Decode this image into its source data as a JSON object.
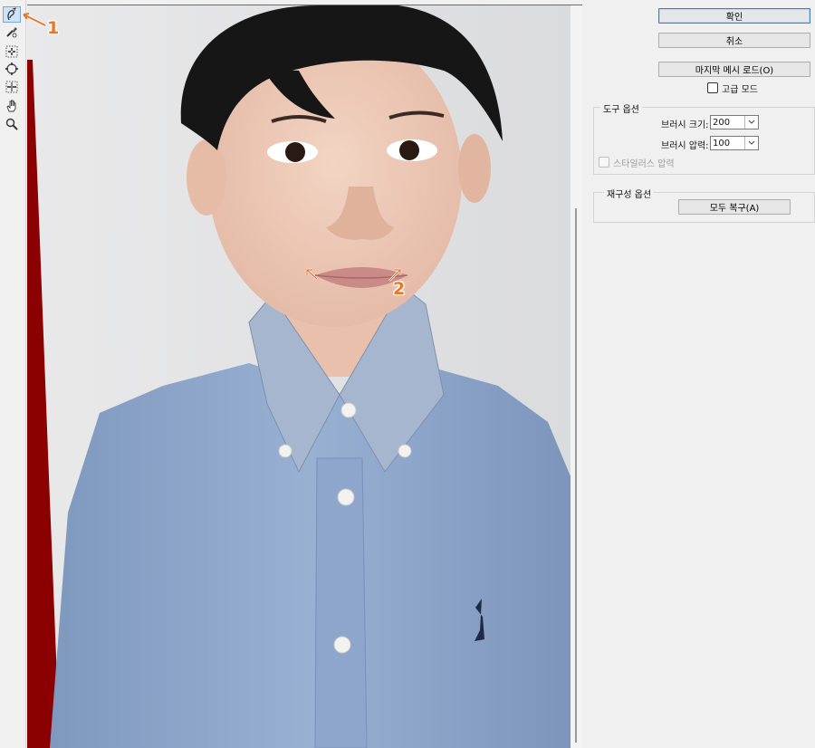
{
  "dialog": {
    "buttons": {
      "ok": "확인",
      "cancel": "취소",
      "load_last_mesh": "마지막 메시 로드(O)"
    },
    "advanced_mode_label": "고급 모드",
    "tool_options": {
      "title": "도구 옵션",
      "brush_size_label": "브러시 크기:",
      "brush_size_value": "200",
      "brush_pressure_label": "브러시 압력:",
      "brush_pressure_value": "100",
      "stylus_pressure_label": "스타일러스 압력"
    },
    "reconstruct_options": {
      "title": "재구성 옵션",
      "restore_all": "모두 복구(A)"
    }
  },
  "toolbar": {
    "tools": [
      "forward-warp-tool-icon",
      "reconstruct-tool-icon",
      "pucker-tool-icon",
      "bloat-tool-icon",
      "push-left-tool-icon",
      "hand-tool-icon",
      "zoom-tool-icon"
    ],
    "active_tool": "forward-warp-tool-icon"
  },
  "annotations": {
    "callout_1": "1",
    "callout_2": "2",
    "color": "#e8772a"
  },
  "colors": {
    "accent": "#3c7fc8",
    "panel_bg": "#f0f0f0",
    "backdrop_red": "#8b0000",
    "shirt_blue": "#8fa8cc"
  }
}
